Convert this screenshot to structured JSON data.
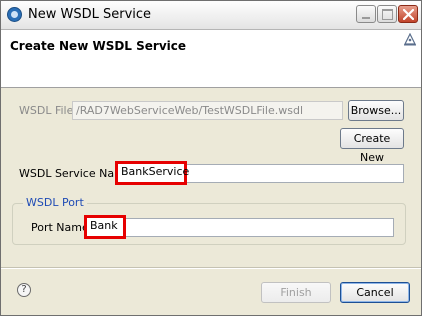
{
  "window": {
    "title": "New WSDL Service"
  },
  "banner": {
    "title": "Create New WSDL Service"
  },
  "wsdl_file": {
    "label": "WSDL File",
    "value": "/RAD7WebServiceWeb/TestWSDLFile.wsdl",
    "browse_label": "Browse...",
    "create_new_label": "Create New"
  },
  "service_name": {
    "label": "WSDL Service Name",
    "value": "BankService"
  },
  "port_group": {
    "legend": "WSDL Port",
    "port_label": "Port Name",
    "port_value": "Bank"
  },
  "footer": {
    "help_symbol": "?",
    "finish_label": "Finish",
    "cancel_label": "Cancel"
  },
  "colors": {
    "highlight": "#e60000",
    "group_legend": "#1f4bb5",
    "dialog_bg": "#ece9d8"
  }
}
